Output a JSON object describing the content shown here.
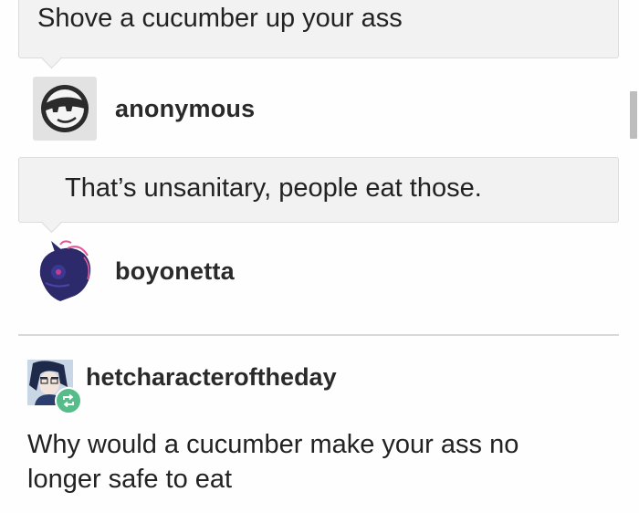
{
  "thread": {
    "question_1": "Shove a cucumber up your ass",
    "asker_1": "anonymous",
    "question_2": "That’s unsanitary, people eat those.",
    "asker_2": "boyonetta",
    "reblogger": "hetcharacteroftheday",
    "reply": "Why would a cucumber make your ass no longer safe to eat"
  },
  "icons": {
    "anon_avatar": "sunglasses-face-icon",
    "boyo_avatar": "pony-avatar-icon",
    "reblog_avatar": "character-avatar-icon",
    "reblog_badge": "reblog-icon"
  },
  "colors": {
    "bubble_bg": "#f2f2f2",
    "reblog_green": "#56bc8a"
  }
}
